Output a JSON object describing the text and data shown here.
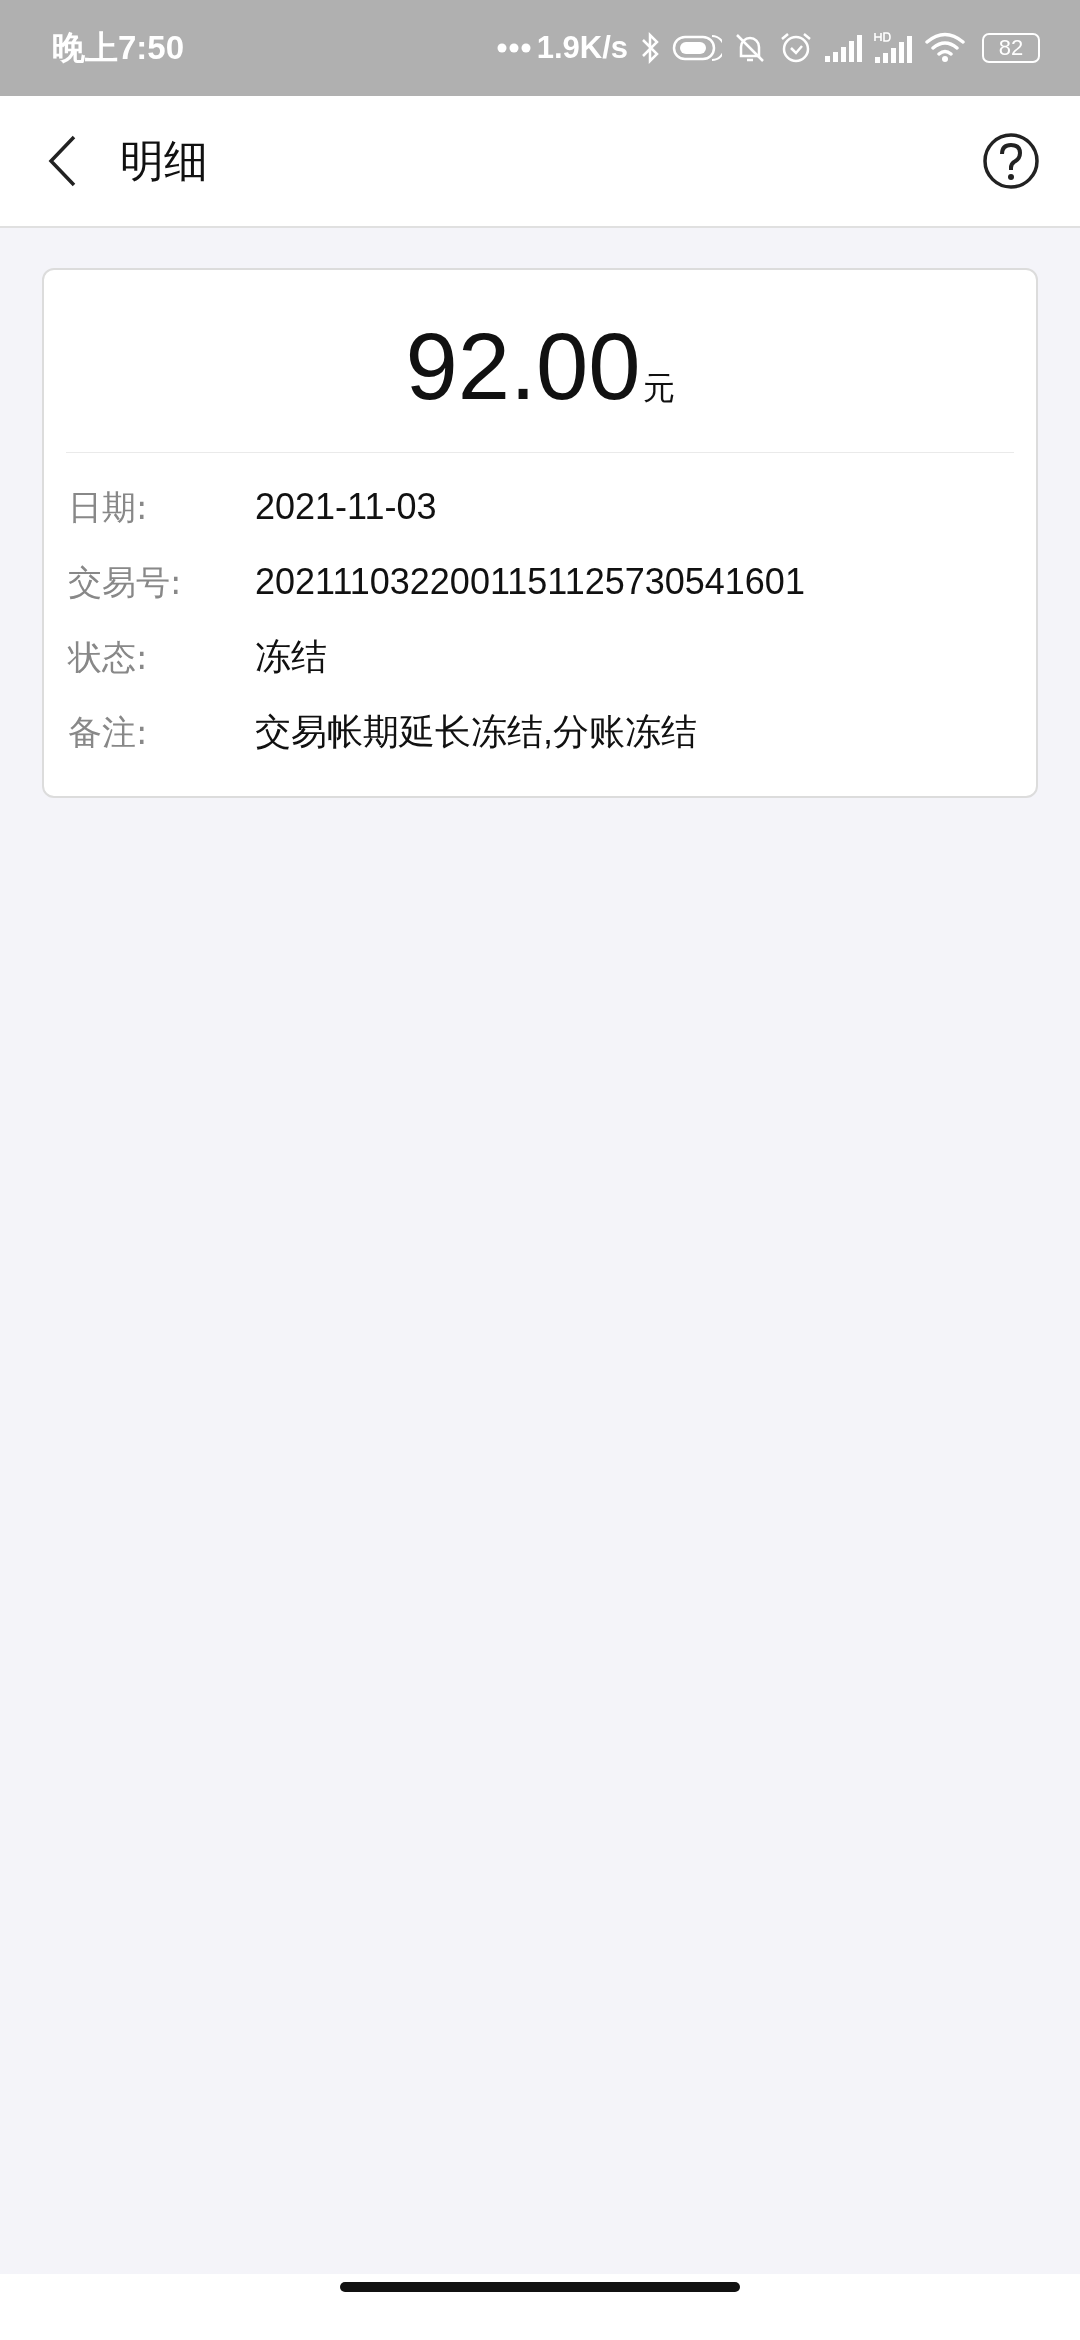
{
  "status_bar": {
    "time": "晚上7:50",
    "net_speed": "1.9K/s",
    "battery": "82"
  },
  "header": {
    "title": "明细"
  },
  "amount": {
    "value": "92.00",
    "unit": "元"
  },
  "details": [
    {
      "label": "日期:",
      "value": "2021-11-03"
    },
    {
      "label": "交易号:",
      "value": "2021110322001151125730541601"
    },
    {
      "label": "状态:",
      "value": "冻结"
    },
    {
      "label": "备注:",
      "value": "交易帐期延长冻结,分账冻结"
    }
  ]
}
